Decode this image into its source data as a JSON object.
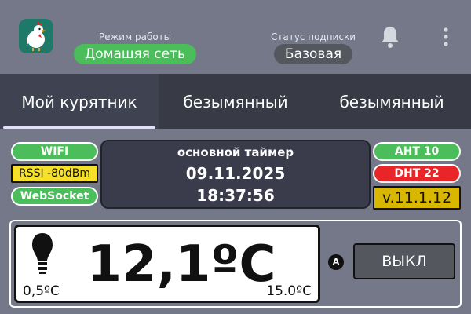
{
  "header": {
    "mode_caption": "Режим работы",
    "mode_value": "Домашяя сеть",
    "subscription_caption": "Статус подписки",
    "subscription_value": "Базовая"
  },
  "tabs": [
    {
      "label": "Мой курятник",
      "active": true
    },
    {
      "label": "безымянный",
      "active": false
    },
    {
      "label": "безымянный",
      "active": false
    }
  ],
  "status_left": {
    "wifi": "WIFI",
    "rssi": "RSSI -80dBm",
    "websocket": "WebSocket"
  },
  "timer": {
    "title": "основной таймер",
    "date": "09.11.2025",
    "time": "18:37:56"
  },
  "status_right": {
    "sensor1": "AHT 10",
    "sensor2": "DHT 22",
    "version": "v.11.1.12"
  },
  "temperature": {
    "value": "12,1ºC",
    "min": "0,5ºC",
    "max": "15.0ºC",
    "mode_badge": "A",
    "button_label": "ВЫКЛ"
  },
  "colors": {
    "background": "#747889",
    "tabs_bar": "#383b46",
    "green": "#4bbd5a",
    "red": "#e8262a",
    "yellow": "#f5e12a",
    "version_gold": "#d9b700",
    "dark_panel": "#3a3c4b"
  },
  "icons": {
    "logo": "rooster-logo-icon",
    "notifications": "bell-icon",
    "menu": "kebab-menu-icon",
    "lamp": "lightbulb-icon"
  }
}
